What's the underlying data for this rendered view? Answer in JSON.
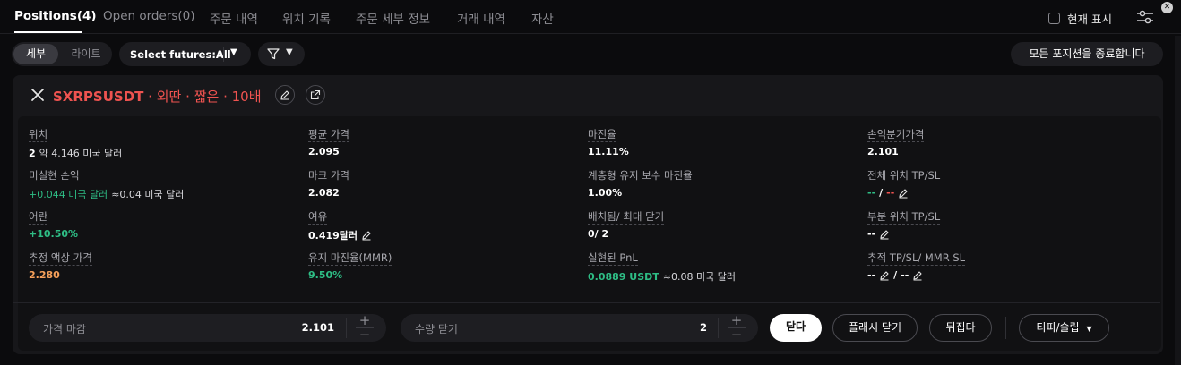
{
  "tabs": [
    {
      "label": "Positions(4)",
      "active": true
    },
    {
      "label": "Open orders(0)",
      "active": false
    },
    {
      "label": "주문 내역",
      "active": false
    },
    {
      "label": "위치 기록",
      "active": false
    },
    {
      "label": "주문 세부 정보",
      "active": false
    },
    {
      "label": "거래 내역",
      "active": false
    },
    {
      "label": "자산",
      "active": false
    }
  ],
  "toolbar": {
    "show_current_label": "현재 표시",
    "view_detail": "세부",
    "view_lite": "라이트",
    "futures_select": "Select futures:All",
    "close_all": "모든 포지션을 종료합니다"
  },
  "position": {
    "symbol": "SXRPSUSDT",
    "side": "외딴",
    "direction": "짧은",
    "leverage": "10배",
    "separator": "·",
    "fields": {
      "size_label": "위치",
      "size_value": "2",
      "size_sub": "약 4.146 미국 달러",
      "avg_price_label": "평균 가격",
      "avg_price_value": "2.095",
      "margin_rate_label": "마진율",
      "margin_rate_value": "11.11%",
      "breakeven_label": "손익분기가격",
      "breakeven_value": "2.101",
      "upnl_label": "미실현 손익",
      "upnl_value": "+0.044 미국 달러",
      "upnl_sub": "≈0.04 미국 달러",
      "mark_price_label": "마크 가격",
      "mark_price_value": "2.082",
      "tiered_mmr_label": "계층형 유지 보수 마진율",
      "tiered_mmr_value": "1.00%",
      "full_tpsl_label": "전체 위치 TP/SL",
      "full_tpsl_tp": "--",
      "full_tpsl_slash": "/",
      "full_tpsl_sl": "--",
      "roe_label": "어란",
      "roe_value": "+10.50%",
      "margin_label": "여유",
      "margin_value": "0.419달러",
      "adl_label": "배치됨/ 최대 닫기",
      "adl_value": "0/ 2",
      "partial_tpsl_label": "부분 위치 TP/SL",
      "partial_tpsl_value": "--",
      "liq_price_label": "추정 액상 가격",
      "liq_price_value": "2.280",
      "mmr_label": "유지 마진율(MMR)",
      "mmr_value": "9.50%",
      "realized_pnl_label": "실현된 PnL",
      "realized_pnl_value": "0.0889 USDT",
      "realized_pnl_sub": "≈0.08 미국 달러",
      "trailing_label": "추적 TP/SL/ MMR SL",
      "trailing_a": "--",
      "trailing_slash": "/",
      "trailing_b": "--"
    }
  },
  "controls": {
    "price_close_label": "가격 마감",
    "price_close_value": "2.101",
    "qty_close_label": "수량 닫기",
    "qty_close_value": "2",
    "plus": "+",
    "minus": "−",
    "close_button": "닫다",
    "flash_close_button": "플래시 닫기",
    "reverse_button": "뒤집다",
    "tpsl_button": "티피/슬립"
  },
  "colors": {
    "short_red": "#ef5350",
    "profit_green": "#2ebd85",
    "liq_orange": "#f6a05a"
  },
  "icons": [
    "x-logo-icon",
    "edit-icon",
    "share-icon",
    "settings-sliders-icon",
    "filter-icon",
    "chevron-down-icon",
    "close-icon"
  ]
}
